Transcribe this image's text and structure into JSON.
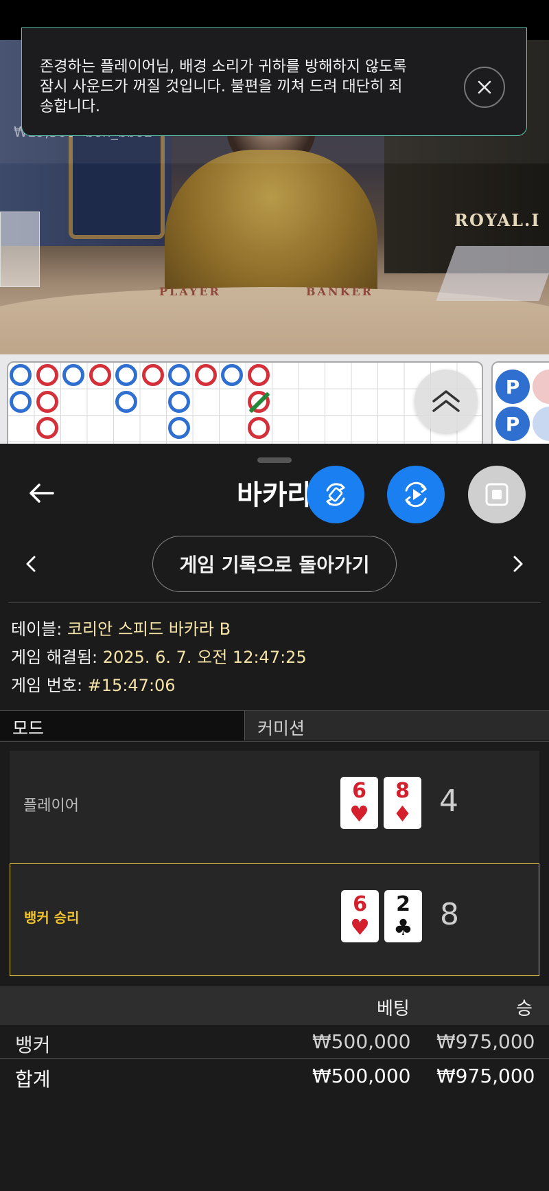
{
  "toast": {
    "message": "존경하는 플레이어님, 배경 소리가 귀하를 방해하지 않도록\n잠시 사운드가 꺼질 것입니다. 불편을 끼쳐 드려 대단히 죄\n송합니다."
  },
  "video": {
    "bet_amount": "₩19,500",
    "bet_user": "bon_bb02",
    "table_player_label": "PLAYER",
    "table_banker_label": "BANKER",
    "brand": "ROYAL.I"
  },
  "roadmap": {
    "bead_letter": "P"
  },
  "sheet": {
    "title": "바카라",
    "back_history_label": "게임 기록으로 돌아가기"
  },
  "info": {
    "table_label": "테이블: ",
    "table_value": "코리안 스피드 바카라 B",
    "resolved_label": "게임 해결됨: ",
    "resolved_value": "2025. 6. 7. 오전 12:47:25",
    "number_label": "게임 번호: ",
    "number_value": "#15:47:06"
  },
  "mode": {
    "left": "모드",
    "right": "커미션"
  },
  "hands": {
    "player": {
      "label": "플레이어",
      "cards": [
        {
          "rank": "6",
          "suit": "♥"
        },
        {
          "rank": "8",
          "suit": "♦"
        }
      ],
      "score": "4"
    },
    "banker": {
      "label": "뱅커 승리",
      "cards": [
        {
          "rank": "6",
          "suit": "♥"
        },
        {
          "rank": "2",
          "suit": "♣"
        }
      ],
      "score": "8"
    }
  },
  "bets": {
    "headers": {
      "bet": "베팅",
      "win": "승"
    },
    "rows": [
      {
        "name": "뱅커",
        "bet": "₩500,000",
        "win": "₩975,000"
      }
    ],
    "total": {
      "name": "합계",
      "bet": "₩500,000",
      "win": "₩975,000"
    }
  },
  "colors": {
    "accent_blue": "#1a7ff0",
    "win_gold": "#f2c22a",
    "info_value": "#f4e2a6",
    "toast_border": "#5fc4ad"
  }
}
